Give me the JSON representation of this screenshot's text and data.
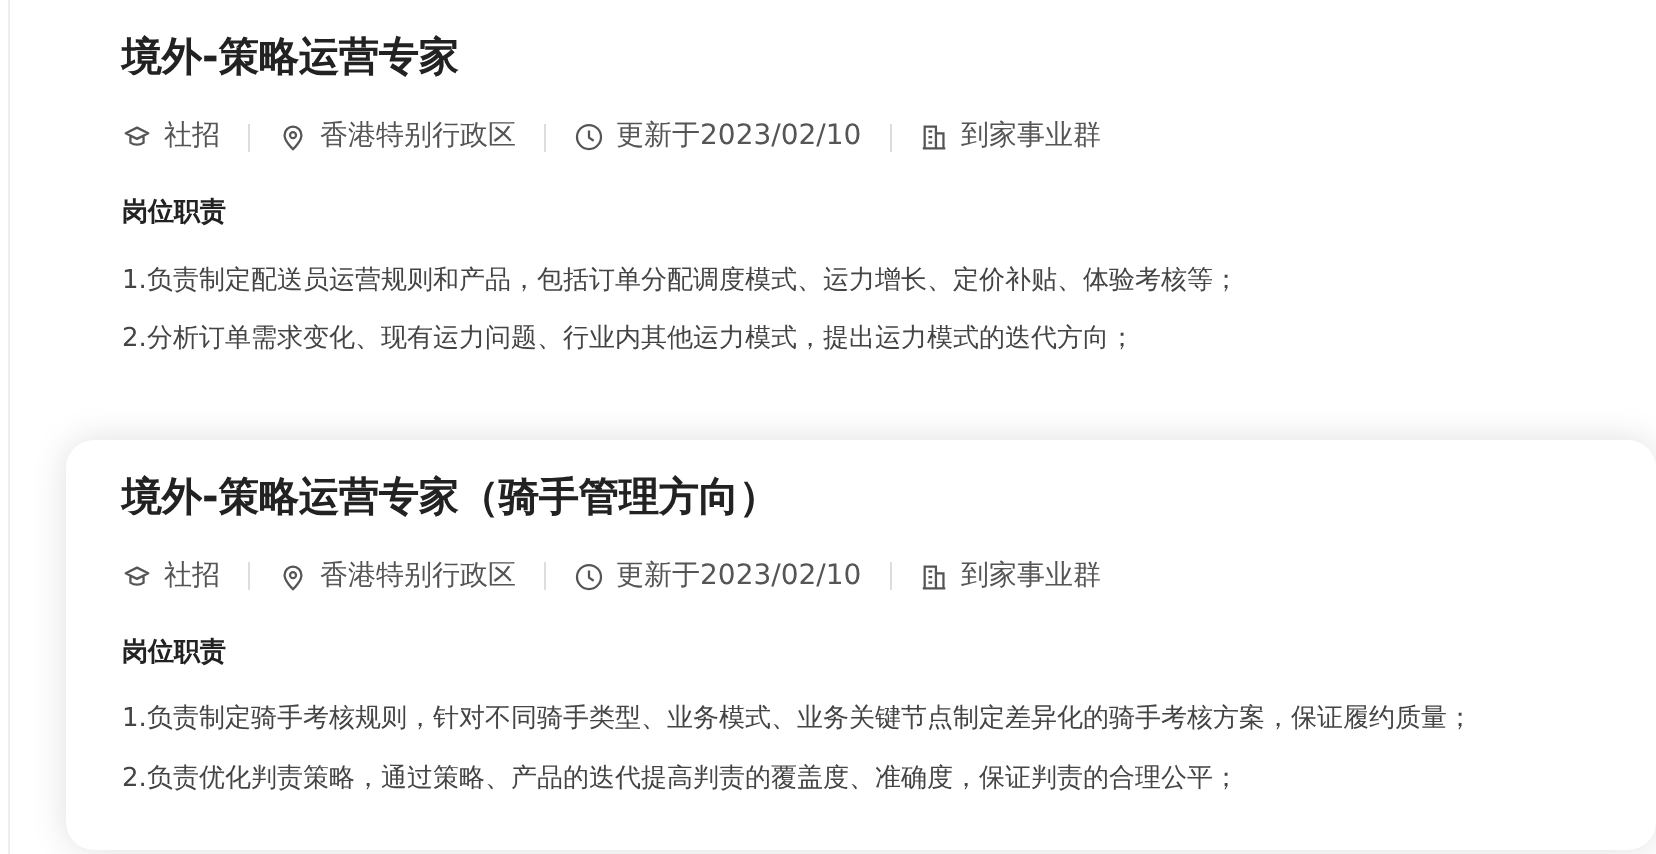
{
  "jobs": [
    {
      "title": "境外-策略运营专家",
      "highlighted": false,
      "meta": [
        {
          "kind": "type",
          "text": "社招"
        },
        {
          "kind": "location",
          "text": "香港特别行政区"
        },
        {
          "kind": "updated",
          "text": "更新于2023/02/10"
        },
        {
          "kind": "department",
          "text": "到家事业群"
        }
      ],
      "section_title": "岗位职责",
      "duties": [
        "1.负责制定配送员运营规则和产品，包括订单分配调度模式、运力增长、定价补贴、体验考核等；",
        "2.分析订单需求变化、现有运力问题、行业内其他运力模式，提出运力模式的迭代方向；"
      ]
    },
    {
      "title": "境外-策略运营专家（骑手管理方向）",
      "highlighted": true,
      "meta": [
        {
          "kind": "type",
          "text": "社招"
        },
        {
          "kind": "location",
          "text": "香港特别行政区"
        },
        {
          "kind": "updated",
          "text": "更新于2023/02/10"
        },
        {
          "kind": "department",
          "text": "到家事业群"
        }
      ],
      "section_title": "岗位职责",
      "duties": [
        "1.负责制定骑手考核规则，针对不同骑手类型、业务模式、业务关键节点制定差异化的骑手考核方案，保证履约质量；",
        "2.负责优化判责策略，通过策略、产品的迭代提高判责的覆盖度、准确度，保证判责的合理公平；"
      ]
    }
  ]
}
